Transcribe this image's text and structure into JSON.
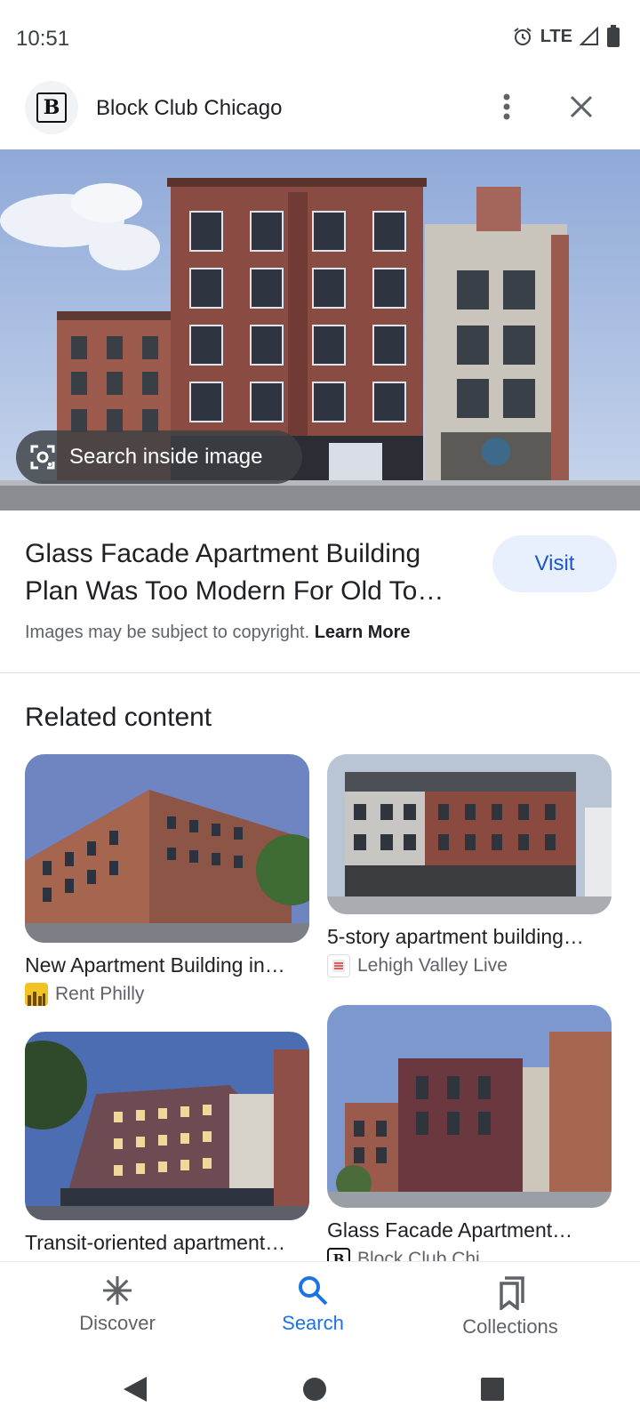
{
  "status_bar": {
    "time": "10:51",
    "network": "LTE",
    "icons": [
      "alarm-icon",
      "signal-icon",
      "battery-icon"
    ]
  },
  "header": {
    "source_logo_letter": "B",
    "source_name": "Block Club Chicago",
    "more_icon": "more-vert-icon",
    "close_icon": "close-icon"
  },
  "hero": {
    "lens_chip_label": "Search inside image",
    "lens_icon": "lens-icon"
  },
  "result": {
    "title": "Glass Facade Apartment Building Plan Was Too Modern For Old To…",
    "visit_label": "Visit",
    "copyright_text": "Images may be subject to copyright.",
    "learn_more_label": "Learn More"
  },
  "related": {
    "heading": "Related content",
    "cards": [
      {
        "caption": "New Apartment Building in…",
        "source": "Rent Philly"
      },
      {
        "caption": "5-story apartment building…",
        "source": "Lehigh Valley Live"
      },
      {
        "caption": "Transit-oriented apartment…",
        "source": ""
      },
      {
        "caption": "Glass Facade Apartment…",
        "source": "Block Club Chi…"
      }
    ]
  },
  "bottom_nav": {
    "items": [
      {
        "label": "Discover",
        "icon": "asterisk-icon"
      },
      {
        "label": "Search",
        "icon": "search-icon"
      },
      {
        "label": "Collections",
        "icon": "bookmarks-icon"
      }
    ],
    "active": "Search"
  },
  "colors": {
    "accent": "#1a73e8",
    "visit_bg": "#e8f0fe",
    "brick": "#8a4b42"
  }
}
